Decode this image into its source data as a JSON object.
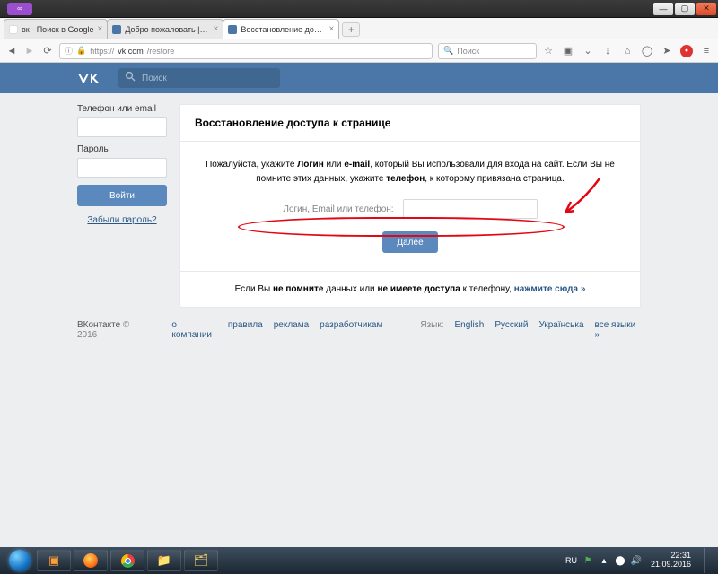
{
  "window": {
    "badge": "∞"
  },
  "tabs": [
    {
      "label": "вк - Поиск в Google",
      "favicon": "#4285f4"
    },
    {
      "label": "Добро пожаловать | ВКон…",
      "favicon": "#4a76a8"
    },
    {
      "label": "Восстановление доступа …",
      "favicon": "#4a76a8"
    }
  ],
  "url": {
    "proto": "https://",
    "host": "vk.com",
    "path": "/restore"
  },
  "browser_search_placeholder": "Поиск",
  "vk": {
    "search_placeholder": "Поиск"
  },
  "side": {
    "login_label": "Телефон или email",
    "password_label": "Пароль",
    "signin": "Войти",
    "forgot": "Забыли пароль?"
  },
  "main": {
    "title": "Восстановление доступа к странице",
    "p1a": "Пожалуйста, укажите ",
    "p1b": "Логин",
    "p1c": " или ",
    "p1d": "e-mail",
    "p1e": ", который Вы использовали для входа на сайт. Если Вы не помните этих данных, укажите ",
    "p1f": "телефон",
    "p1g": ", к которому привязана страница.",
    "input_label": "Логин, Email или телефон:",
    "next": "Далее",
    "bot_a": "Если Вы ",
    "bot_b": "не помните",
    "bot_c": " данных или ",
    "bot_d": "не имеете доступа",
    "bot_e": " к телефону, ",
    "bot_link": "нажмите сюда »"
  },
  "footer": {
    "brand": "ВКонтакте",
    "copy": "© 2016",
    "links": [
      "о компании",
      "правила",
      "реклама",
      "разработчикам"
    ],
    "lang_label": "Язык:",
    "langs": [
      "English",
      "Русский",
      "Українська",
      "все языки »"
    ]
  },
  "tray": {
    "lang": "RU",
    "time": "22:31",
    "date": "21.09.2016"
  }
}
